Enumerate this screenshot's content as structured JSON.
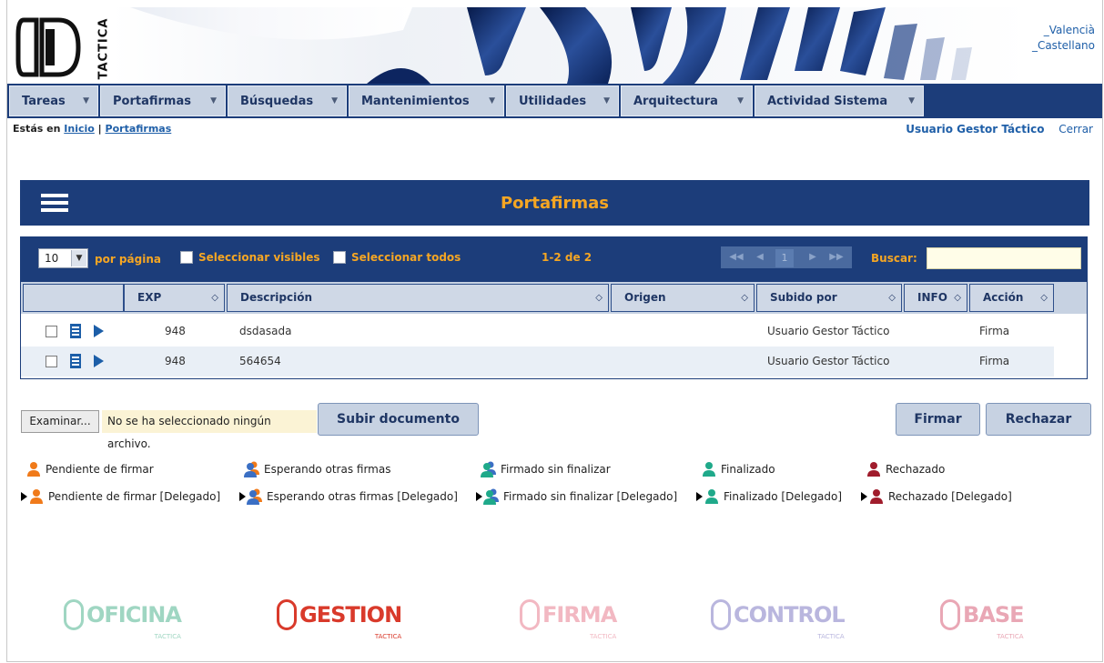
{
  "header": {
    "logo_text": "TACTICA",
    "languages": [
      "_Valencià",
      "_Castellano"
    ]
  },
  "nav": [
    {
      "label": "Tareas"
    },
    {
      "label": "Portafirmas"
    },
    {
      "label": "Búsquedas"
    },
    {
      "label": "Mantenimientos"
    },
    {
      "label": "Utilidades"
    },
    {
      "label": "Arquitectura"
    },
    {
      "label": "Actividad Sistema"
    }
  ],
  "breadcrumb": {
    "prefix": "Estás en",
    "home": "Inicio",
    "separator": "|",
    "current": "Portafirmas"
  },
  "user": {
    "name": "Usuario Gestor Táctico",
    "logout": "Cerrar"
  },
  "page_title": "Portafirmas",
  "grid": {
    "page_size": "10",
    "per_page_label": "por página",
    "select_visible": "Seleccionar visibles",
    "select_all": "Seleccionar todos",
    "range": "1-2 de 2",
    "current_page": "1",
    "search_label": "Buscar:",
    "search_value": "",
    "columns": [
      "EXP",
      "Descripción",
      "Origen",
      "Subido por",
      "INFO",
      "Acción"
    ],
    "rows": [
      {
        "exp": "948",
        "descripcion": "dsdasada",
        "origen": "",
        "subido_por": "Usuario Gestor Táctico",
        "info": "",
        "accion": "Firma"
      },
      {
        "exp": "948",
        "descripcion": "564654",
        "origen": "",
        "subido_por": "Usuario Gestor Táctico",
        "info": "",
        "accion": "Firma"
      }
    ]
  },
  "upload": {
    "browse_label": "Examinar...",
    "no_file_text": "No se ha seleccionado ningún archivo.",
    "upload_label": "Subir documento"
  },
  "actions": {
    "sign": "Firmar",
    "reject": "Rechazar"
  },
  "legend": {
    "row1": [
      "Pendiente de firmar",
      "Esperando otras firmas",
      "Firmado sin finalizar",
      "Finalizado",
      "Rechazado"
    ],
    "row2": [
      "Pendiente de firmar [Delegado]",
      "Esperando otras firmas [Delegado]",
      "Firmado sin finalizar [Delegado]",
      "Finalizado [Delegado]",
      "Rechazado [Delegado]"
    ],
    "colors": [
      "#f07a1a",
      "#3b6fc4",
      "#1fa98a",
      "#1fa98a",
      "#a01c2c"
    ]
  },
  "footer_logos": [
    {
      "name": "OFICINA",
      "sub": "TACTICA",
      "color": "#9fd6c2"
    },
    {
      "name": "GESTION",
      "sub": "TACTICA",
      "color": "#d93a2b"
    },
    {
      "name": "FIRMA",
      "sub": "TACTICA",
      "color": "#f2b8c2"
    },
    {
      "name": "CONTROL",
      "sub": "TACTICA",
      "color": "#b9b6de"
    },
    {
      "name": "BASE",
      "sub": "TACTICA",
      "color": "#e9a7b5"
    }
  ],
  "colors": {
    "navy": "#1c3d7a",
    "accent": "#f5a623",
    "link": "#1f5fa8"
  }
}
